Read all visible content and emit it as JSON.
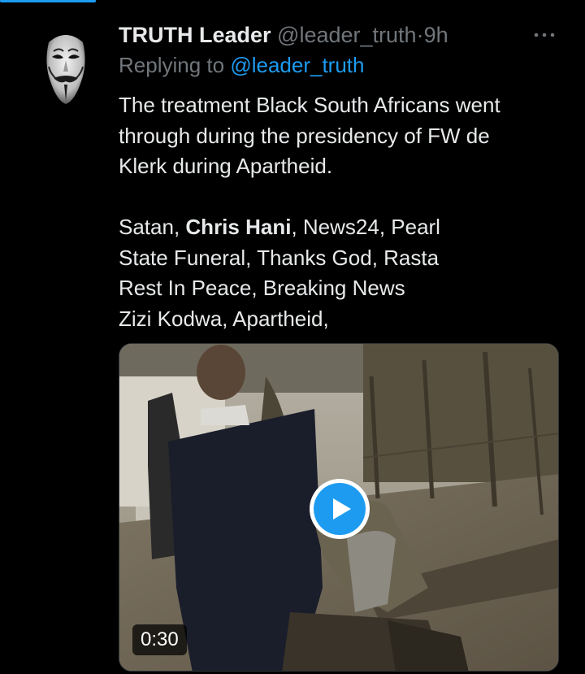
{
  "colors": {
    "background": "#000000",
    "text_primary": "#e7e9ea",
    "text_secondary": "#71767b",
    "accent": "#1d9bf0"
  },
  "tweet": {
    "author_name": "TRUTH Leader",
    "handle": "@leader_truth",
    "separator": "·",
    "time": "9h",
    "reply_prefix": "Replying to",
    "reply_to": "@leader_truth",
    "text_lines": [
      "The treatment Black South Africans went",
      "through during the presidency of FW de",
      "Klerk during Apartheid."
    ],
    "tags": {
      "line1_a": "Satan, ",
      "line1_bold": "Chris Hani",
      "line1_b": ", News24, Pearl",
      "line2": "State Funeral, Thanks God, Rasta",
      "line3": "Rest In Peace, Breaking News",
      "line4": "Zizi Kodwa, Apartheid,"
    },
    "avatar_icon": "guy-fawkes-mask-icon",
    "more_icon": "more-horizontal-icon"
  },
  "video": {
    "duration": "0:30",
    "play_icon": "play-icon"
  }
}
